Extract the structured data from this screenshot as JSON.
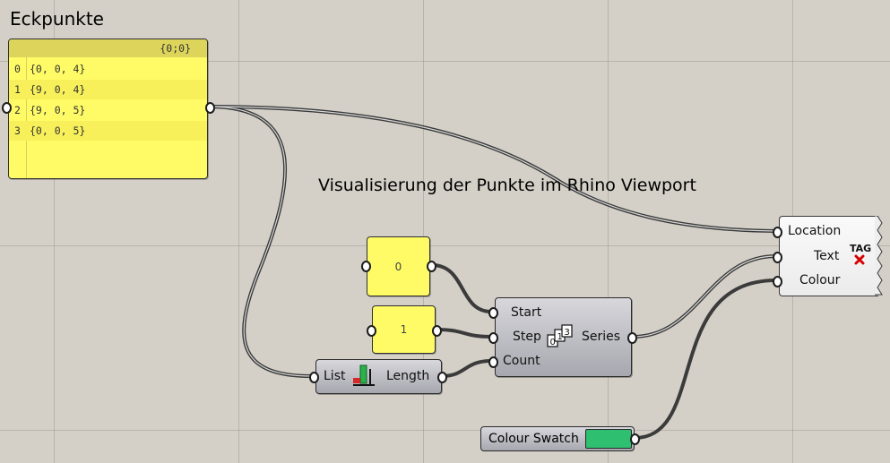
{
  "canvas": {
    "title_left": "Eckpunkte",
    "title_center": "Visualisierung der Punkte im Rhino Viewport"
  },
  "panel": {
    "header": "{0;0}",
    "rows": [
      {
        "index": "0",
        "value": "{0, 0, 4}"
      },
      {
        "index": "1",
        "value": "{9, 0, 4}"
      },
      {
        "index": "2",
        "value": "{9, 0, 5}"
      },
      {
        "index": "3",
        "value": "{0, 0, 5}"
      }
    ]
  },
  "params": {
    "start_value": "0",
    "step_value": "1"
  },
  "series": {
    "inputs": [
      "Start",
      "Step",
      "Count"
    ],
    "output": "Series"
  },
  "list_length": {
    "input": "List",
    "output": "Length"
  },
  "tag": {
    "inputs": [
      "Location",
      "Text",
      "Colour"
    ],
    "icon_text": "TAG"
  },
  "swatch": {
    "label": "Colour Swatch",
    "color": "#2fbf71"
  },
  "colors": {
    "panel_yellow": "#fffb66",
    "wire": "#3b3b3b",
    "component_grey": "#b5b6bc"
  }
}
